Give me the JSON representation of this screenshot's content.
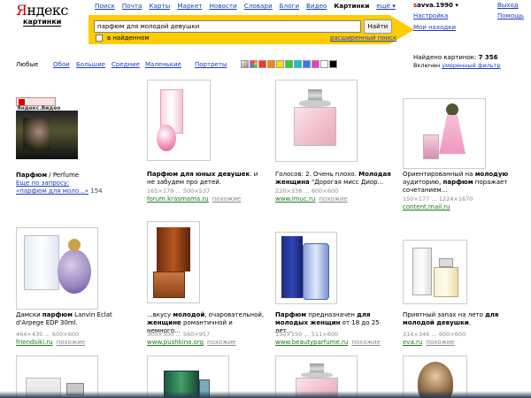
{
  "logo": {
    "text_y": "Я",
    "text_rest": "ндекс",
    "subtitle": "картинки"
  },
  "topnav": [
    "Поиск",
    "Почта",
    "Карты",
    "Маркет",
    "Новости",
    "Словари",
    "Блоги",
    "Видео",
    "Картинки",
    "ещё ▾"
  ],
  "user": {
    "first": "s",
    "rest": "avva.1990 ▾",
    "logout": "Выход",
    "settings": "Настройка",
    "help": "Помощь",
    "my_finds": "Мои находки"
  },
  "search": {
    "query": "парфюм для молодой девушки",
    "button": "Найти",
    "in_found": "в найденном",
    "advanced": "расширенный поиск"
  },
  "filters": {
    "favorites": "Любые",
    "wallpapers": "Обои",
    "large": "Большие",
    "medium": "Средние",
    "small": "Маленькие",
    "portraits": "Портреты",
    "swatches": [
      "#c0c0c0",
      "#d040ff",
      "#ff3030",
      "#ff8800",
      "#ffdd00",
      "#33cc33",
      "#00cccc",
      "#3377ff",
      "#ff33cc",
      "#ffffff",
      "#000000"
    ]
  },
  "found": {
    "label": "Найдено картинок:",
    "count": "7 356",
    "filter_prefix": "Включен ",
    "filter_link": "умеренный фильтр"
  },
  "video": {
    "badge": "Яндекс.Видео",
    "title_b": "Парфюм",
    "title_rest": " / Perfume",
    "more": "Еще по запросу:",
    "query_link": "«парфюм для моло...»",
    "count": "154"
  },
  "results": [
    {
      "caption_pre": "",
      "caption_b": "Парфюм для",
      "caption_post": " ",
      "caption_b2": "юных девушек",
      "caption_post2": ". и не забудем про детей.",
      "meta": "165×179 … 500×537",
      "site": "forum.krasmama.ru",
      "similar": "похожие"
    },
    {
      "caption_pre": "Голосов: 2. Очень плохо. ",
      "caption_b": "Молодая женщина",
      "caption_post": " \"Дорогая мисс Диор...",
      "caption_b2": "",
      "caption_post2": "",
      "meta": "220×338 … 600×600",
      "site": "www.imuc.ru",
      "similar": "похожие"
    },
    {
      "caption_pre": "Ориентированный на ",
      "caption_b": "молодую",
      "caption_post": " аудиторию, ",
      "caption_b2": "парфюм",
      "caption_post2": " поражает сочетанием...",
      "meta": "150×177 … 1224×1670",
      "site": "content.mail.ru",
      "similar": ""
    },
    {
      "caption_pre": "Дамски ",
      "caption_b": "парфюм",
      "caption_post": " Lanvin Eclat d'Arpege EDP 30ml.",
      "caption_b2": "",
      "caption_post2": "",
      "meta": "464×435 … 600×600",
      "site": "friendsiki.ru",
      "similar": "похожие"
    },
    {
      "caption_pre": "...вкусу ",
      "caption_b": "молодой",
      "caption_post": ", очаровательной, ",
      "caption_b2": "женщине",
      "caption_post2": " романтичной и немного...",
      "meta": "300×300 … 560×957",
      "site": "www.pushkino.org",
      "similar": "похожие"
    },
    {
      "caption_pre": "",
      "caption_b": "Парфюм",
      "caption_post": " предназначен ",
      "caption_b2": "для молодых женщин",
      "caption_post2": " от 18 до 25 лет...",
      "meta": "150×150 … 511×600",
      "site": "www.beautyparfume.ru",
      "similar": "похожие"
    },
    {
      "caption_pre": "Приятный запах на лето ",
      "caption_b": "для молодой девушки",
      "caption_post": ".",
      "caption_b2": "",
      "caption_post2": "",
      "meta": "314×346 … 600×600",
      "site": "eva.ru",
      "similar": "похожие"
    }
  ]
}
